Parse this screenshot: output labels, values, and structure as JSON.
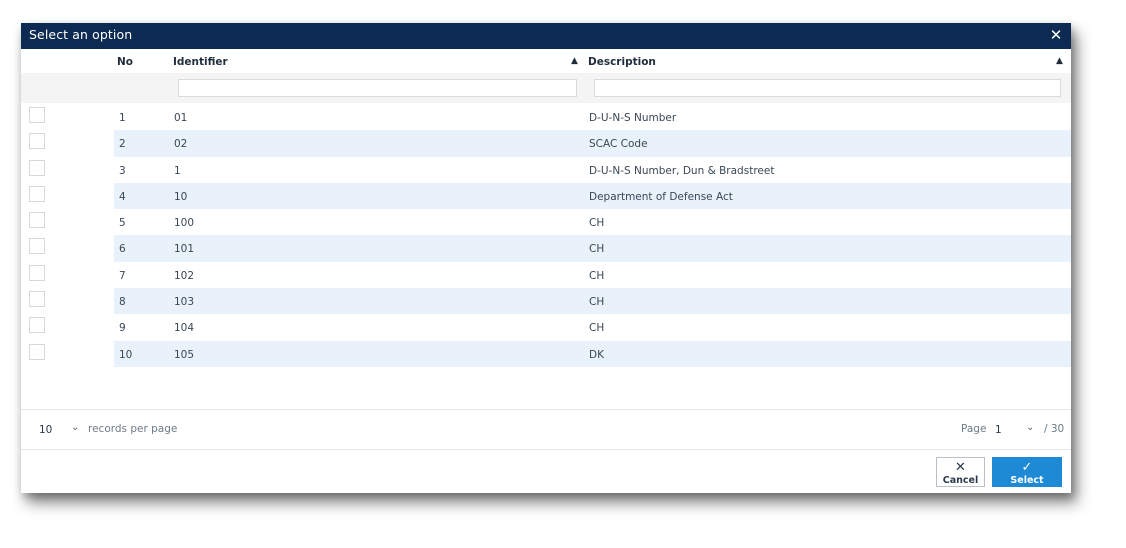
{
  "dialog": {
    "title": "Select an option",
    "close_icon": "close-icon"
  },
  "table": {
    "headers": {
      "no": "No",
      "identifier": "Identifier",
      "description": "Description"
    },
    "filters": {
      "identifier": "",
      "description": ""
    },
    "rows": [
      {
        "no": "1",
        "identifier": "01",
        "description": "D-U-N-S Number"
      },
      {
        "no": "2",
        "identifier": "02",
        "description": "SCAC Code"
      },
      {
        "no": "3",
        "identifier": "1",
        "description": "D-U-N-S Number, Dun & Bradstreet"
      },
      {
        "no": "4",
        "identifier": "10",
        "description": "Department of Defense Act"
      },
      {
        "no": "5",
        "identifier": "100",
        "description": "CH"
      },
      {
        "no": "6",
        "identifier": "101",
        "description": "CH"
      },
      {
        "no": "7",
        "identifier": "102",
        "description": "CH"
      },
      {
        "no": "8",
        "identifier": "103",
        "description": "CH"
      },
      {
        "no": "9",
        "identifier": "104",
        "description": "CH"
      },
      {
        "no": "10",
        "identifier": "105",
        "description": "DK"
      }
    ]
  },
  "pagination": {
    "records_per_page": "10",
    "records_per_page_label": "records per page",
    "page_label": "Page",
    "current_page": "1",
    "total_pages": "/ 30"
  },
  "buttons": {
    "cancel_label": "Cancel",
    "select_label": "Select"
  },
  "colors": {
    "titlebar": "#0c2a52",
    "row_stripe": "#e9f1fa",
    "primary": "#1e8ad6"
  }
}
